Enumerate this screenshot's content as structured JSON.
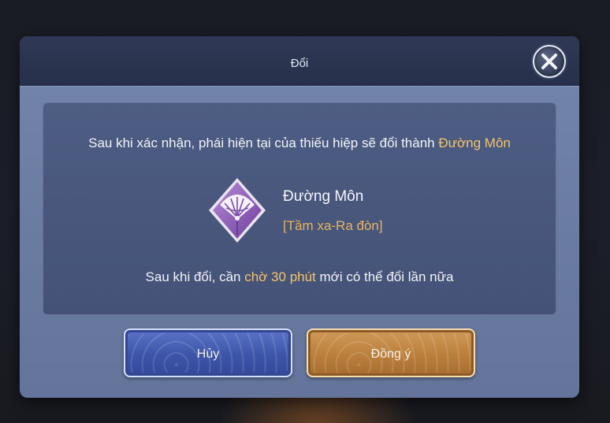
{
  "dialog": {
    "title": "Đổi",
    "close_icon": "close-x-icon"
  },
  "content": {
    "confirm_text_prefix": "Sau khi xác nhận, phái hiện tại của thiếu hiệp sẽ đổi thành ",
    "confirm_text_highlight": "Đường Môn",
    "sect": {
      "icon": "fan-emblem-icon",
      "name": "Đường Môn",
      "tag": "[Tầm xa-Ra đòn]"
    },
    "cooldown_prefix": "Sau khi đổi, cần ",
    "cooldown_highlight": "chờ 30 phút",
    "cooldown_suffix": " mới có thể đổi lần nữa"
  },
  "buttons": {
    "cancel_label": "Hủy",
    "confirm_label": "Đồng ý"
  },
  "colors": {
    "highlight": "#f2c46a",
    "header_bg": "#2f3955",
    "panel_bg": "#7486ad",
    "cancel_btn": "#3d55a8",
    "confirm_btn": "#bb7f3c"
  }
}
